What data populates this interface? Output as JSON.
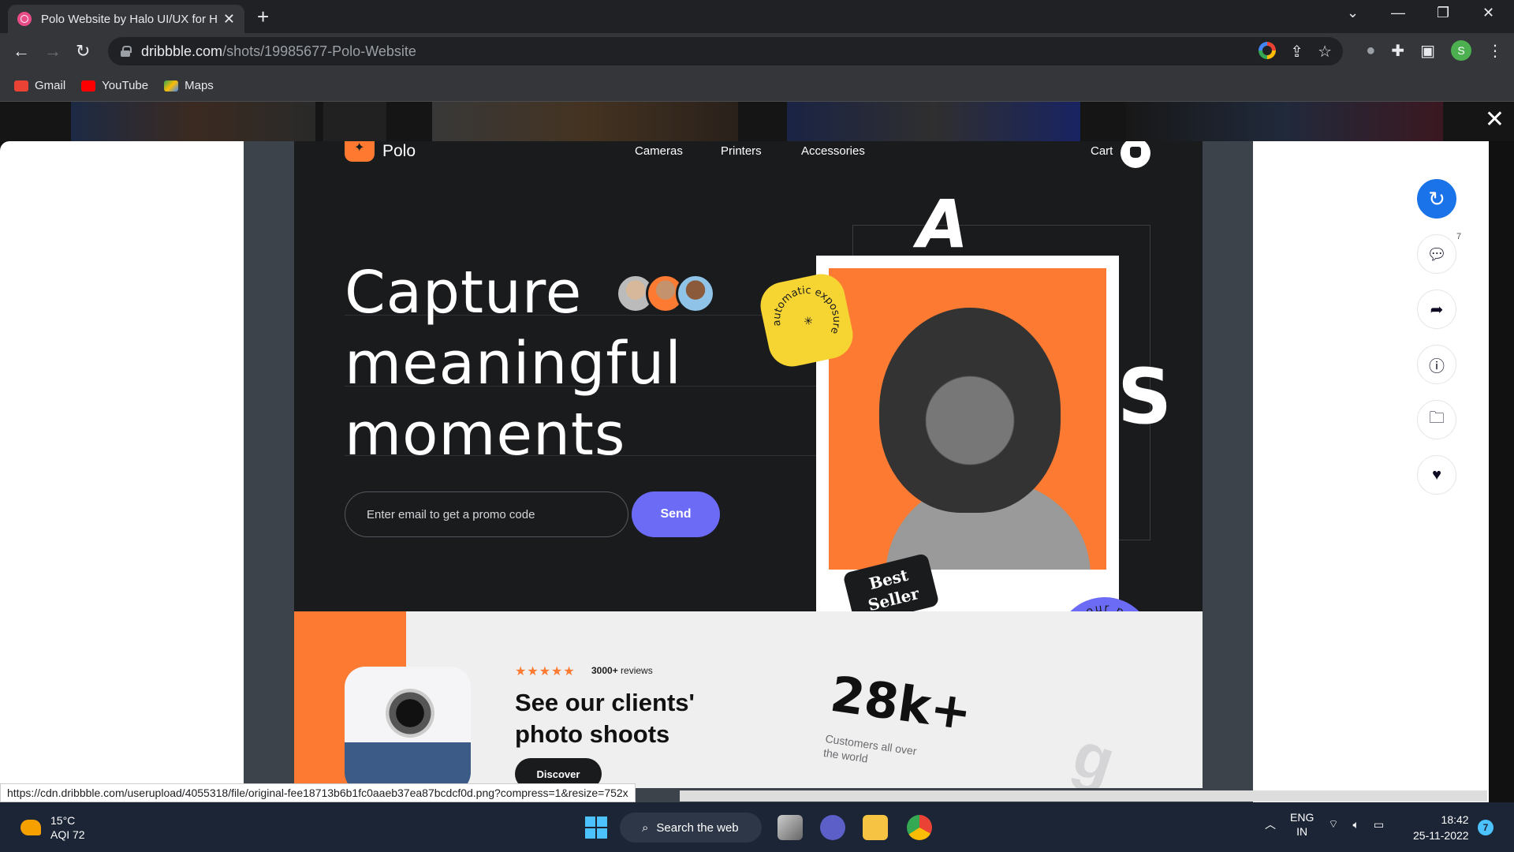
{
  "browser": {
    "tab_title": "Polo Website by Halo UI/UX for H",
    "url_host": "dribbble.com",
    "url_path": "/shots/19985677-Polo-Website",
    "profile_initial": "S",
    "bookmarks": [
      {
        "label": "Gmail",
        "color": "#ea4335"
      },
      {
        "label": "YouTube",
        "color": "#ff0000"
      },
      {
        "label": "Maps",
        "color": "#34a853"
      }
    ]
  },
  "shot": {
    "brand": "Polo",
    "menu": [
      "Cameras",
      "Printers",
      "Accessories"
    ],
    "cart_label": "Cart",
    "headline": [
      "Capture",
      "meaningful",
      "moments"
    ],
    "email_placeholder": "Enter email to get a promo code",
    "send_label": "Send",
    "big_letter_a": "A",
    "big_letter_s": "S",
    "sticker_text": "automatic exposure",
    "best_seller": [
      "Best",
      "Seller"
    ],
    "view_badge_text": "view our product review",
    "stars": "★★★★★",
    "reviews_count": "3000+",
    "reviews_label": "reviews",
    "clients_heading": [
      "See our clients'",
      "photo shoots"
    ],
    "discover_label": "Discover",
    "stat_value": "28k+",
    "stat_caption": [
      "Customers all over",
      "the world"
    ],
    "deco_letter": "g",
    "accent_orange": "#fd7a32",
    "accent_purple": "#6b6bf6"
  },
  "rail": {
    "comments_count": "7"
  },
  "status_url": "https://cdn.dribbble.com/userupload/4055318/file/original-fee18713b6b1fc0aaeb37ea87bcdcf0d.png?compress=1&resize=752x",
  "taskbar": {
    "temperature": "15°C",
    "aqi": "AQI 72",
    "search_label": "Search the web",
    "lang": "ENG",
    "region": "IN",
    "time": "18:42",
    "date": "25-11-2022",
    "notifications": "7"
  }
}
